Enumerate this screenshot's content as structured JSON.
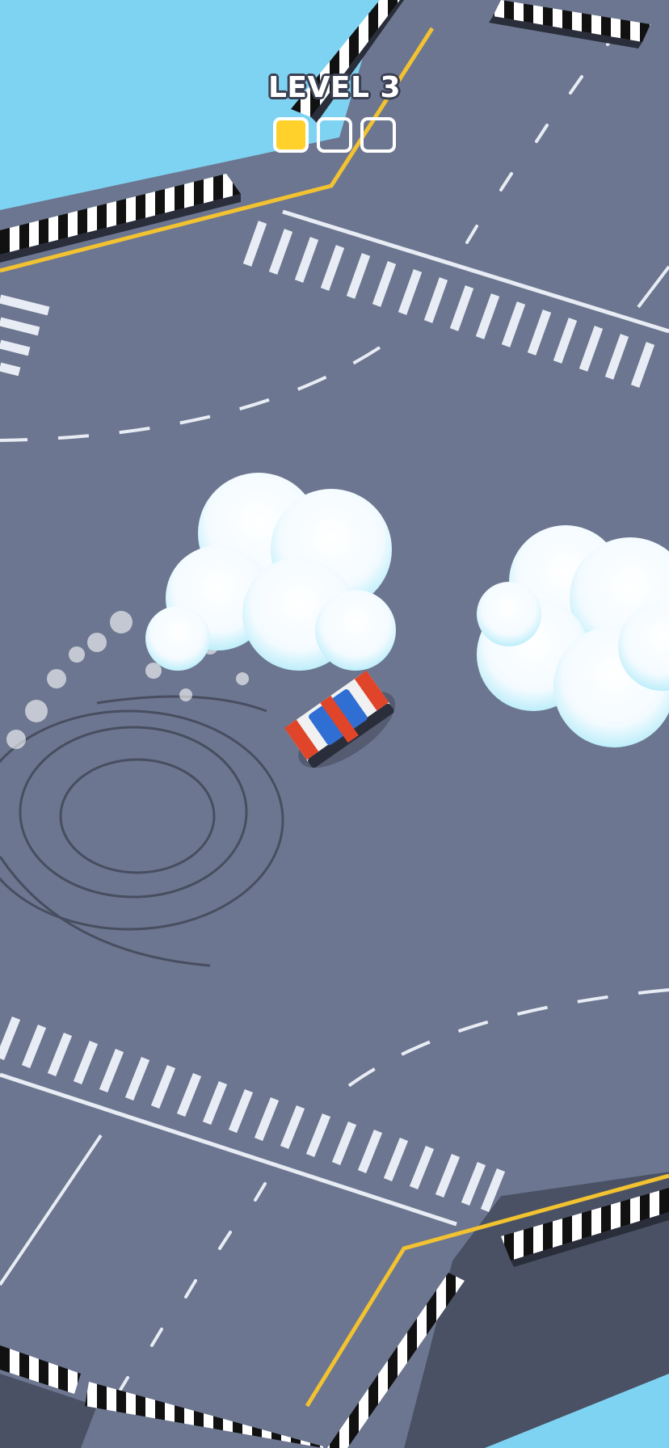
{
  "hud": {
    "level_label": "LEVEL 3",
    "progress": {
      "completed": 1,
      "total": 3
    }
  },
  "colors": {
    "sky": "#7fd3f2",
    "road": "#6c7690",
    "road_dark": "#5d6781",
    "wall": "#4a5164",
    "lane_marking": "#e8ecf4",
    "center_line": "#f2c230",
    "progress_fill": "#ffd12a",
    "car_body": "#f1f1f1",
    "car_stripe": "#e0452a",
    "car_glass": "#2f6fd4",
    "smoke": "#ffffff"
  },
  "icons": [
    "car-sprite",
    "smoke-cloud-icon",
    "tire-marks",
    "barrier-stripes"
  ]
}
